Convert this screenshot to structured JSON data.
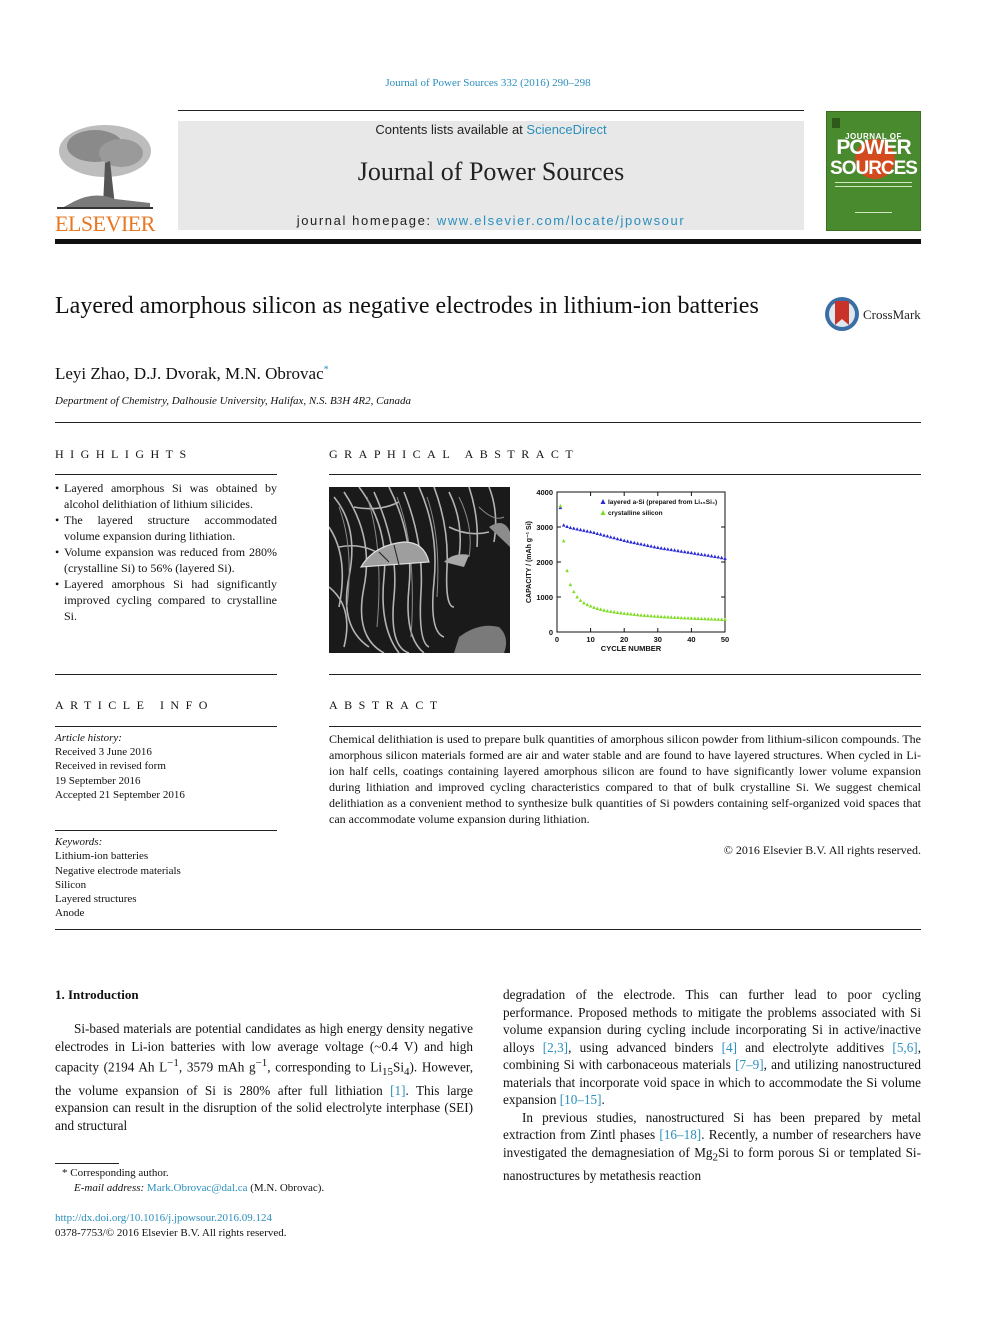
{
  "header": {
    "citation": "Journal of Power Sources 332 (2016) 290–298",
    "publisher": "ELSEVIER",
    "contents_prefix": "Contents lists available at ",
    "contents_link": "ScienceDirect",
    "journal_name": "Journal of Power Sources",
    "homepage_prefix": "journal homepage: ",
    "homepage_link": "www.elsevier.com/locate/jpowsour",
    "cover": {
      "line1": "JOURNAL OF",
      "line2": "POWER",
      "line3": "SOURCES",
      "color": "#4a8a2e"
    }
  },
  "article": {
    "title": "Layered amorphous silicon as negative electrodes in lithium-ion batteries",
    "crossmark_label": "CrossMark",
    "authors": "Leyi Zhao, D.J. Dvorak, M.N. Obrovac",
    "corresponding_mark": "*",
    "affiliation": "Department of Chemistry, Dalhousie University, Halifax, N.S. B3H 4R2, Canada"
  },
  "highlights": {
    "heading": "HIGHLIGHTS",
    "items": [
      "Layered amorphous Si was obtained by alcohol delithiation of lithium silicides.",
      "The layered structure accommodated volume expansion during lithiation.",
      "Volume expansion was reduced from 280% (crystalline Si) to 56% (layered Si).",
      "Layered amorphous Si had significantly improved cycling compared to crystalline Si."
    ]
  },
  "graphical_abstract": {
    "heading": "GRAPHICAL ABSTRACT",
    "image_alt": "SEM micrograph of layered amorphous silicon"
  },
  "chart_data": {
    "type": "scatter",
    "title": "",
    "xlabel": "CYCLE NUMBER",
    "ylabel": "CAPACITY / (mAh g⁻¹ Si)",
    "xlim": [
      0,
      50
    ],
    "ylim": [
      0,
      4000
    ],
    "xticks": [
      0,
      10,
      20,
      30,
      40,
      50
    ],
    "yticks": [
      0,
      1000,
      2000,
      3000,
      4000
    ],
    "grid": false,
    "legend_position": "top-right",
    "series": [
      {
        "name": "layered a-Si (prepared from Li₁₅Si₄)",
        "marker": "triangle",
        "color": "#2b2bd6",
        "x": [
          1,
          2,
          3,
          4,
          5,
          6,
          7,
          8,
          9,
          10,
          11,
          12,
          13,
          14,
          15,
          16,
          17,
          18,
          19,
          20,
          21,
          22,
          23,
          24,
          25,
          26,
          27,
          28,
          29,
          30,
          31,
          32,
          33,
          34,
          35,
          36,
          37,
          38,
          39,
          40,
          41,
          42,
          43,
          44,
          45,
          46,
          47,
          48,
          49,
          50
        ],
        "y": [
          3550,
          3050,
          3010,
          2980,
          2960,
          2940,
          2920,
          2900,
          2880,
          2860,
          2840,
          2810,
          2790,
          2760,
          2740,
          2710,
          2690,
          2660,
          2640,
          2610,
          2590,
          2570,
          2550,
          2530,
          2510,
          2490,
          2470,
          2450,
          2430,
          2410,
          2395,
          2380,
          2365,
          2350,
          2335,
          2320,
          2305,
          2290,
          2275,
          2260,
          2245,
          2230,
          2215,
          2200,
          2185,
          2170,
          2155,
          2140,
          2120,
          2100
        ]
      },
      {
        "name": "crystalline silicon",
        "marker": "triangle",
        "color": "#7ddc1f",
        "x": [
          1,
          2,
          3,
          4,
          5,
          6,
          7,
          8,
          9,
          10,
          11,
          12,
          13,
          14,
          15,
          16,
          17,
          18,
          19,
          20,
          21,
          22,
          23,
          24,
          25,
          26,
          27,
          28,
          29,
          30,
          31,
          32,
          33,
          34,
          35,
          36,
          37,
          38,
          39,
          40,
          41,
          42,
          43,
          44,
          45,
          46,
          47,
          48,
          49,
          50
        ],
        "y": [
          3600,
          2600,
          1750,
          1350,
          1150,
          1000,
          900,
          830,
          780,
          740,
          700,
          670,
          645,
          620,
          600,
          585,
          570,
          555,
          545,
          530,
          520,
          510,
          500,
          490,
          480,
          472,
          465,
          458,
          450,
          443,
          437,
          431,
          425,
          420,
          415,
          410,
          405,
          400,
          396,
          392,
          388,
          384,
          380,
          376,
          372,
          368,
          364,
          360,
          357,
          355
        ]
      }
    ]
  },
  "article_info": {
    "heading": "ARTICLE INFO",
    "history_label": "Article history:",
    "history": [
      "Received 3 June 2016",
      "Received in revised form",
      "19 September 2016",
      "Accepted 21 September 2016"
    ],
    "keywords_label": "Keywords:",
    "keywords": [
      "Lithium-ion batteries",
      "Negative electrode materials",
      "Silicon",
      "Layered structures",
      "Anode"
    ]
  },
  "abstract": {
    "heading": "ABSTRACT",
    "text": "Chemical delithiation is used to prepare bulk quantities of amorphous silicon powder from lithium-silicon compounds. The amorphous silicon materials formed are air and water stable and are found to have layered structures. When cycled in Li-ion half cells, coatings containing layered amorphous silicon are found to have significantly lower volume expansion during lithiation and improved cycling characteristics compared to that of bulk crystalline Si. We suggest chemical delithiation as a convenient method to synthesize bulk quantities of Si powders containing self-organized void spaces that can accommodate volume expansion during lithiation.",
    "copyright": "© 2016 Elsevier B.V. All rights reserved."
  },
  "body": {
    "section_heading": "1.  Introduction",
    "left": {
      "p1_a": "Si-based materials are potential candidates as high energy density negative electrodes in Li-ion batteries with low average voltage (~0.4 V) and high capacity (2194 Ah L",
      "p1_sup1": "−1",
      "p1_b": ", 3579 mAh g",
      "p1_sup2": "−1",
      "p1_c": ", corresponding to Li",
      "p1_sub1": "15",
      "p1_d": "Si",
      "p1_sub2": "4",
      "p1_e": "). However, the volume expansion of Si is 280% after full lithiation ",
      "ref1": "[1]",
      "p1_f": ". This large expansion can result in the disruption of the solid electrolyte interphase (SEI) and structural"
    },
    "right": {
      "p1_a": "degradation of the electrode. This can further lead to poor cycling performance. Proposed methods to mitigate the problems associated with Si volume expansion during cycling include incorporating Si in active/inactive alloys ",
      "ref_a": "[2,3]",
      "p1_b": ", using advanced binders ",
      "ref_b": "[4]",
      "p1_c": " and electrolyte additives ",
      "ref_c": "[5,6]",
      "p1_d": ", combining Si with carbonaceous materials ",
      "ref_d": "[7–9]",
      "p1_e": ", and utilizing nanostructured materials that incorporate void space in which to accommodate the Si volume expansion ",
      "ref_e": "[10–15]",
      "p1_f": ".",
      "p2_a": "In previous studies, nanostructured Si has been prepared by metal extraction from Zintl phases ",
      "ref_f": "[16–18]",
      "p2_b": ". Recently, a number of researchers have investigated the demagnesiation of Mg",
      "p2_sub": "2",
      "p2_c": "Si to form porous Si or templated Si-nanostructures by metathesis reaction"
    }
  },
  "footnotes": {
    "corresponding": "* Corresponding author.",
    "email_label": "E-mail address:",
    "email": "Mark.Obrovac@dal.ca",
    "email_suffix": " (M.N. Obrovac).",
    "doi": "http://dx.doi.org/10.1016/j.jpowsour.2016.09.124",
    "issn": "0378-7753/© 2016 Elsevier B.V. All rights reserved."
  }
}
